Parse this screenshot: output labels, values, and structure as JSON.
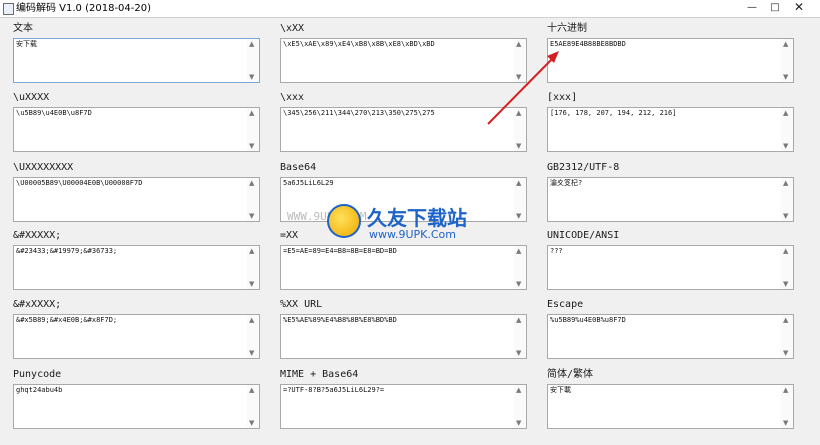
{
  "window": {
    "title": "编码解码 V1.0  (2018-04-20)",
    "controls": {
      "minimize": "—",
      "maximize": "□",
      "close": "✕"
    }
  },
  "fields": [
    {
      "label": "文本",
      "value": "安下载"
    },
    {
      "label": "\\xXX",
      "value": "\\xE5\\xAE\\x89\\xE4\\xB8\\x8B\\xE8\\xBD\\xBD"
    },
    {
      "label": "十六进制",
      "value": "E5AE89E4B88BE8BDBD"
    },
    {
      "label": "\\uXXXX",
      "value": "\\u5B89\\u4E0B\\u8F7D"
    },
    {
      "label": "\\xxx",
      "value": "\\345\\256\\211\\344\\270\\213\\350\\275\\275"
    },
    {
      "label": "[xxx]",
      "value": "[176, 178, 207, 194, 212, 216]"
    },
    {
      "label": "\\UXXXXXXXX",
      "value": "\\U00005B89\\U00004E0B\\U00008F7D"
    },
    {
      "label": "Base64",
      "value": "5a6J5LiL6L29"
    },
    {
      "label": "GB2312/UTF-8",
      "value": "瀹夊笅杞?"
    },
    {
      "label": "&#XXXXX;",
      "value": "&#23433;&#19979;&#36733;"
    },
    {
      "label": "=XX",
      "value": "=E5=AE=89=E4=B8=8B=E8=BD=BD"
    },
    {
      "label": "UNICODE/ANSI",
      "value": "???"
    },
    {
      "label": "&#xXXXX;",
      "value": "&#x5B89;&#x4E0B;&#x8F7D;"
    },
    {
      "label": "%XX   URL",
      "value": "%E5%AE%89%E4%B8%8B%E8%BD%BD"
    },
    {
      "label": "Escape",
      "value": "%u5B89%u4E0B%u8F7D"
    },
    {
      "label": "Punycode",
      "value": "ghqt24abu4b"
    },
    {
      "label": "MIME + Base64",
      "value": "=?UTF-8?B?5a6J5LiL6L29?="
    },
    {
      "label": "简体/繁体",
      "value": "安下載"
    }
  ],
  "scroll": {
    "up": "▲",
    "down": "▼"
  },
  "watermark": {
    "url": "WWW.9UPK.COM",
    "name_cn": "久友下载站",
    "name_en": "www.9UPK.Com"
  },
  "colors": {
    "accent_arrow": "#d42020",
    "watermark_blue": "#1d63c8"
  }
}
